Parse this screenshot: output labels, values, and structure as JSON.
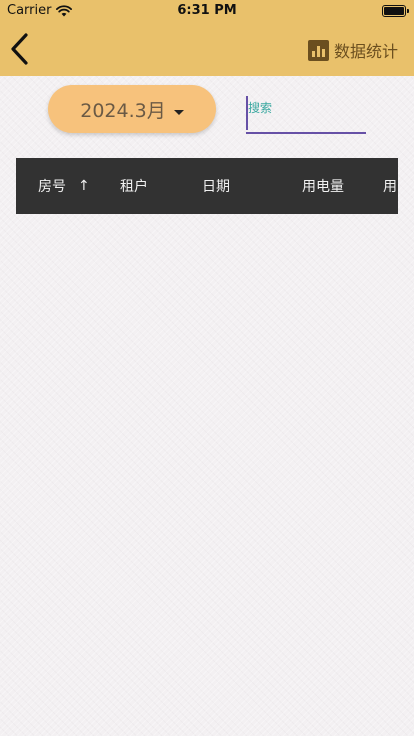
{
  "status_bar": {
    "carrier": "Carrier",
    "time": "6:31 PM"
  },
  "header": {
    "stats_label": "数据统计",
    "back_icon": "chevron-left-icon",
    "stats_icon": "bar-chart-icon"
  },
  "filter": {
    "month": "2024.3月",
    "search_placeholder": "搜索"
  },
  "table": {
    "columns": [
      "房号",
      "租户",
      "日期",
      "用电量",
      "用"
    ],
    "sort_indicator": "↑"
  },
  "colors": {
    "topbar": "#e9c16b",
    "month_button": "#f7c27c",
    "table_header": "#323232",
    "search_underline": "#6650a6",
    "placeholder": "#3aa8a0"
  }
}
